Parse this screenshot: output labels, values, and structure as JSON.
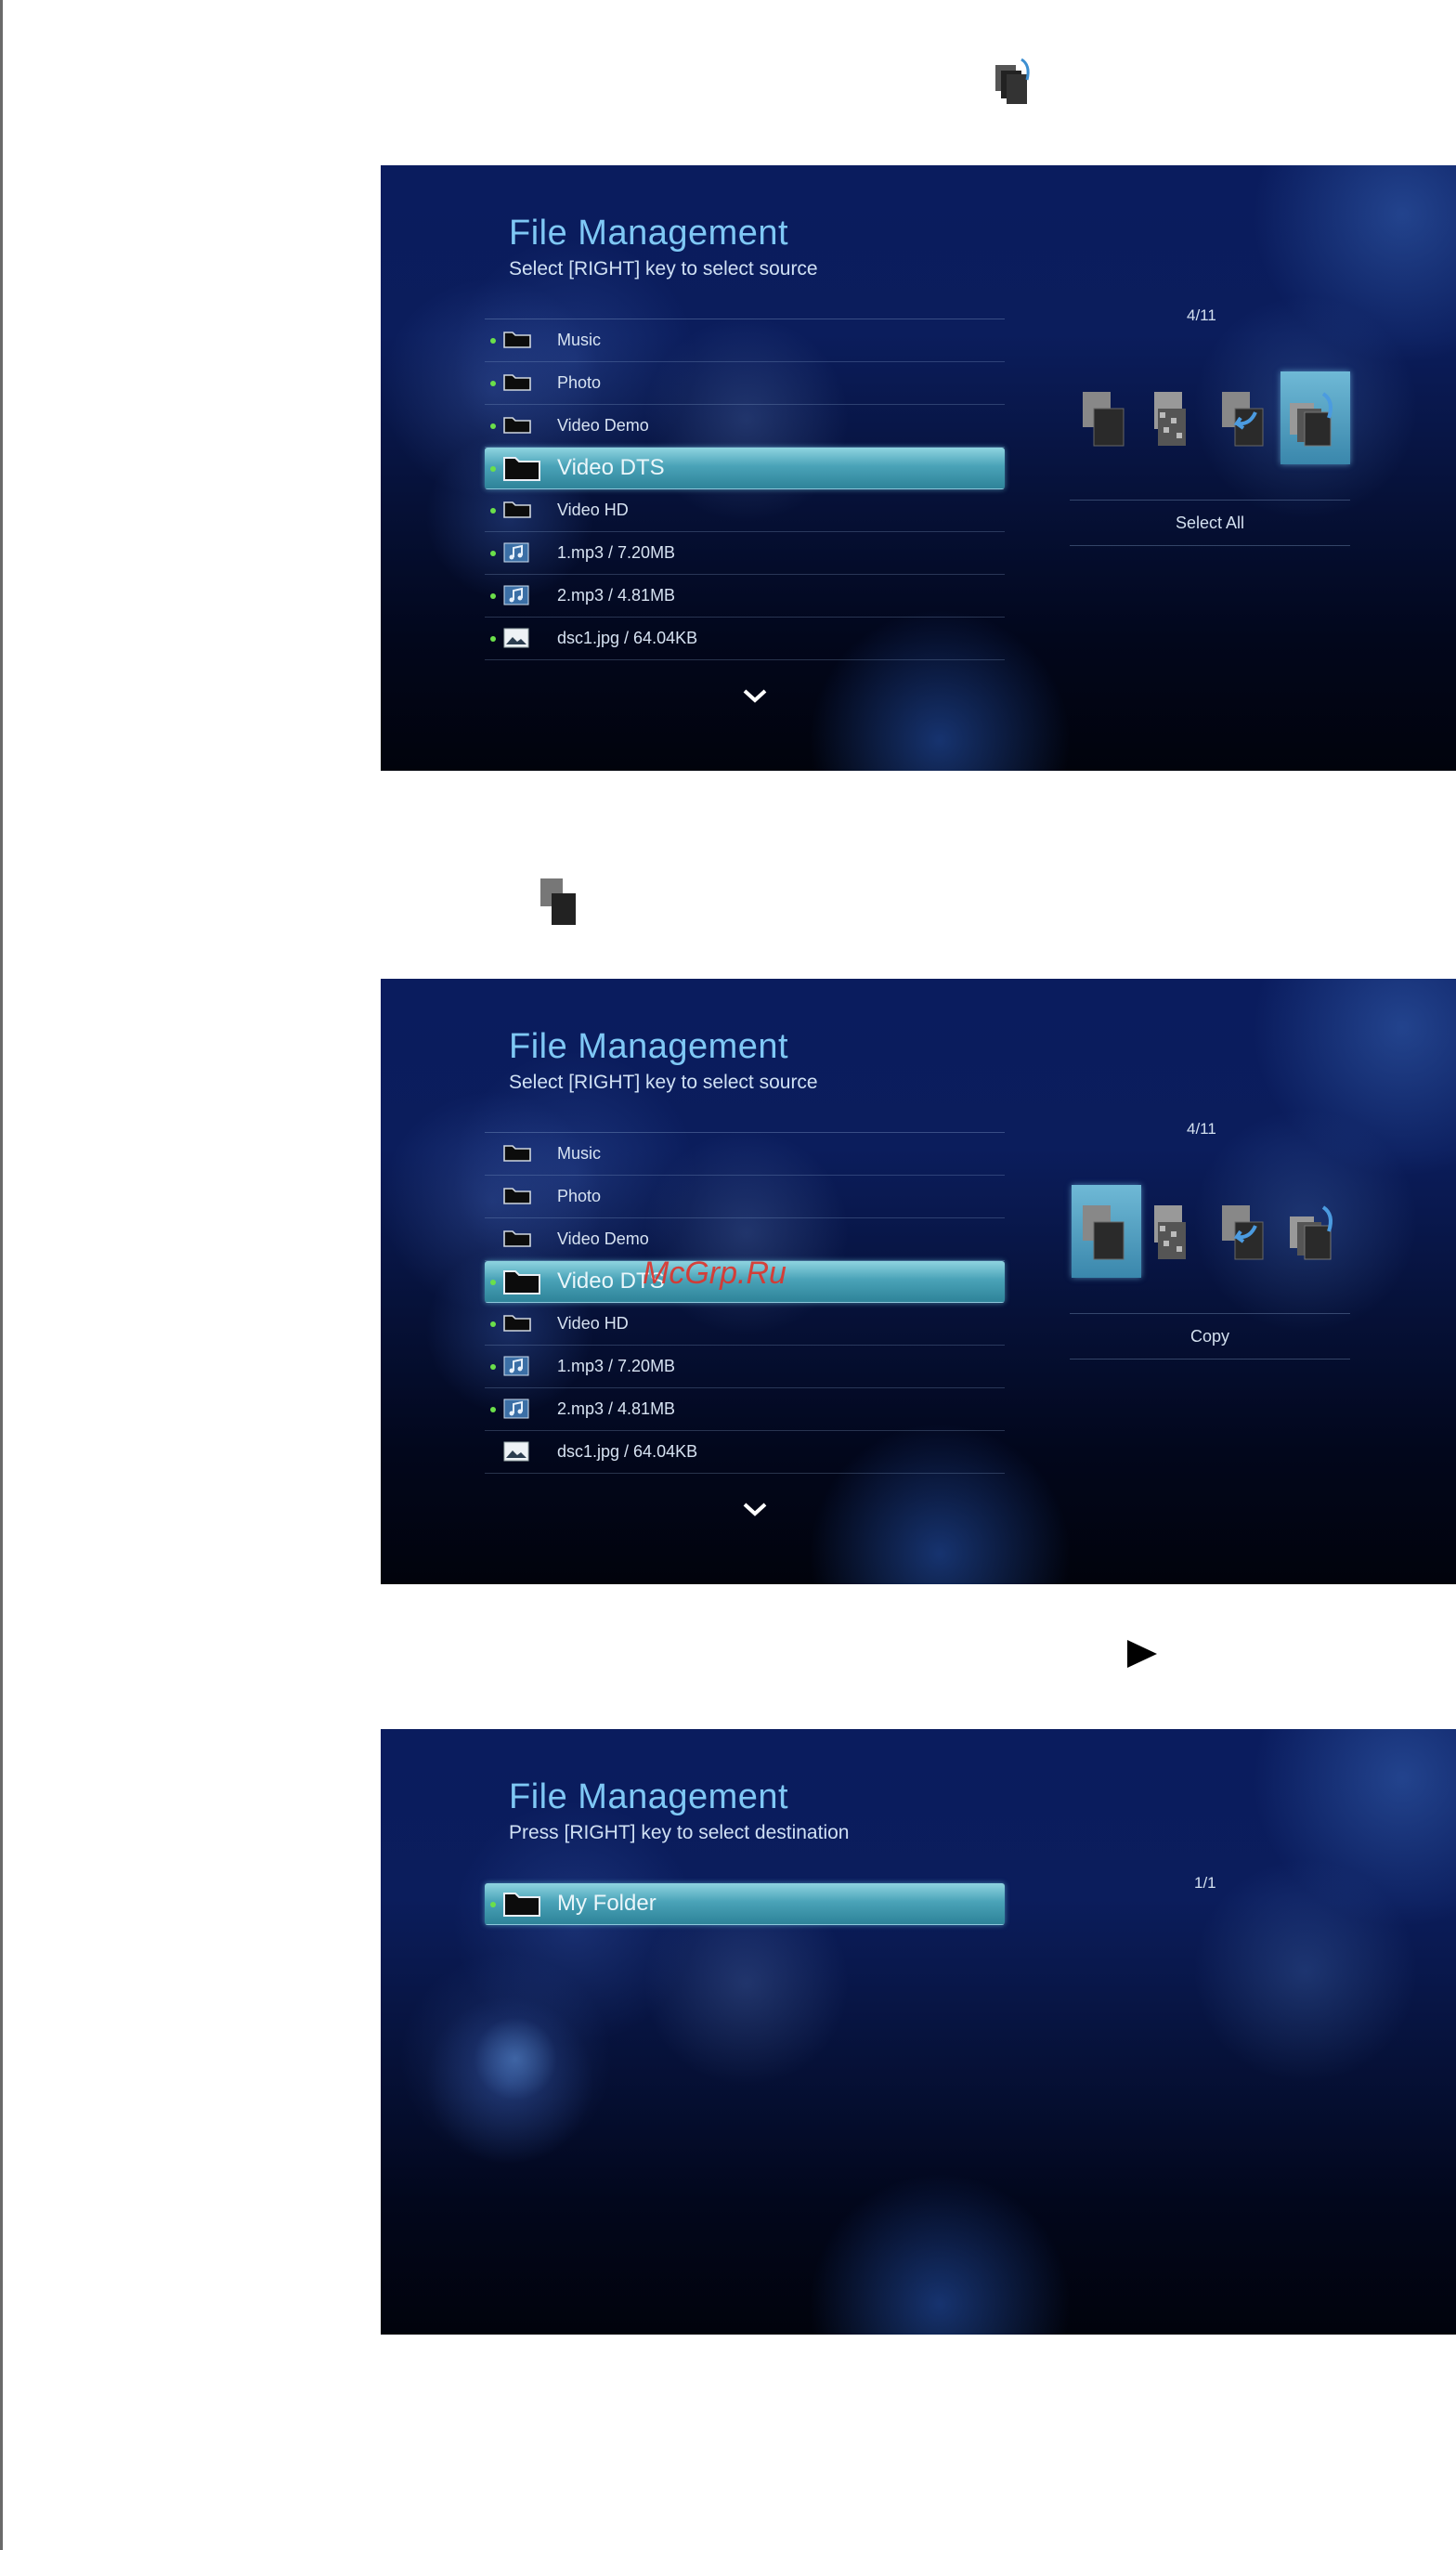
{
  "screens": [
    {
      "title": "File Management",
      "subtitle": "Select [RIGHT] key to select source",
      "page_count": "4/11",
      "action_label": "Select All",
      "items": [
        {
          "label": "Music",
          "icon": "folder-icon",
          "checked": true
        },
        {
          "label": "Photo",
          "icon": "folder-icon",
          "checked": true
        },
        {
          "label": "Video Demo",
          "icon": "folder-icon",
          "checked": true
        },
        {
          "label": "Video DTS",
          "icon": "folder-icon",
          "checked": true,
          "selected": true
        },
        {
          "label": "Video HD",
          "icon": "folder-icon",
          "checked": true
        },
        {
          "label": "1.mp3 / 7.20MB",
          "icon": "music-file-icon",
          "checked": true
        },
        {
          "label": "2.mp3 / 4.81MB",
          "icon": "music-file-icon",
          "checked": true
        },
        {
          "label": "dsc1.jpg / 64.04KB",
          "icon": "photo-file-icon",
          "checked": true
        }
      ]
    },
    {
      "title": "File Management",
      "subtitle": "Select [RIGHT] key to select source",
      "page_count": "4/11",
      "action_label": "Copy",
      "items": [
        {
          "label": "Music",
          "icon": "folder-icon",
          "checked": false
        },
        {
          "label": "Photo",
          "icon": "folder-icon",
          "checked": false
        },
        {
          "label": "Video Demo",
          "icon": "folder-icon",
          "checked": false
        },
        {
          "label": "Video DTS",
          "icon": "folder-icon",
          "checked": true,
          "selected": true
        },
        {
          "label": "Video HD",
          "icon": "folder-icon",
          "checked": true
        },
        {
          "label": "1.mp3 / 7.20MB",
          "icon": "music-file-icon",
          "checked": true
        },
        {
          "label": "2.mp3 / 4.81MB",
          "icon": "music-file-icon",
          "checked": true
        },
        {
          "label": "dsc1.jpg / 64.04KB",
          "icon": "photo-file-icon",
          "checked": false
        }
      ]
    },
    {
      "title": "File Management",
      "subtitle": "Press [RIGHT] key to select destination",
      "page_count": "1/1",
      "items": [
        {
          "label": "My Folder",
          "icon": "folder-icon",
          "checked": true,
          "selected": true
        }
      ]
    }
  ],
  "action_buttons": [
    {
      "name": "copy",
      "icon": "copy-files-icon"
    },
    {
      "name": "delete",
      "icon": "delete-files-icon"
    },
    {
      "name": "move",
      "icon": "move-files-icon"
    },
    {
      "name": "select-all",
      "icon": "select-all-icon"
    }
  ],
  "active_action": [
    "select-all",
    "copy"
  ],
  "inline_icons": [
    "select-all-icon",
    "copy-files-icon",
    "play-arrow-icon"
  ],
  "watermark": "McGrp.Ru",
  "colors": {
    "accent": "#7fc8f5",
    "selection": "#4aa3b8",
    "check_dot": "#6be04a",
    "watermark": "#e0322a"
  }
}
